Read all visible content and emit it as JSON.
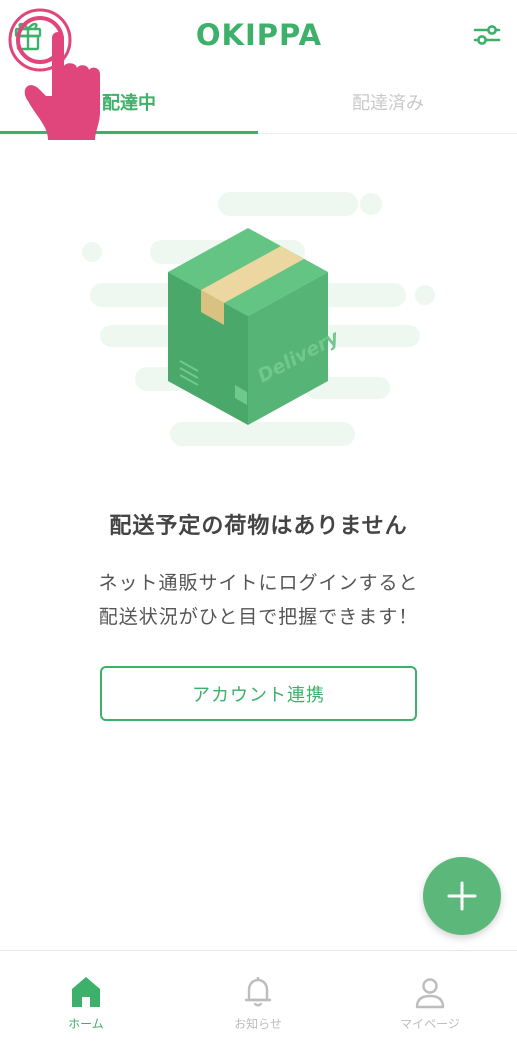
{
  "header": {
    "logo_text": "OKIPPA",
    "gift_icon": "gift-icon",
    "filter_icon": "sliders-icon"
  },
  "tabs": [
    {
      "label": "配達中",
      "active": true
    },
    {
      "label": "配達済み",
      "active": false
    }
  ],
  "empty_state": {
    "box_label": "Delivery",
    "title": "配送予定の荷物はありません",
    "description_line1": "ネット通販サイトにログインすると",
    "description_line2": "配送状況がひと目で把握できます！",
    "button_label": "アカウント連携"
  },
  "fab": {
    "icon": "plus-icon"
  },
  "bottom_nav": [
    {
      "label": "ホーム",
      "icon": "home-icon",
      "active": true
    },
    {
      "label": "お知らせ",
      "icon": "bell-icon",
      "active": false
    },
    {
      "label": "マイページ",
      "icon": "user-icon",
      "active": false
    }
  ],
  "colors": {
    "brand_green": "#3db06a",
    "fab_green": "#5cb87a",
    "touch_pink": "#e0457b",
    "inactive_gray": "#c9c9c9"
  }
}
